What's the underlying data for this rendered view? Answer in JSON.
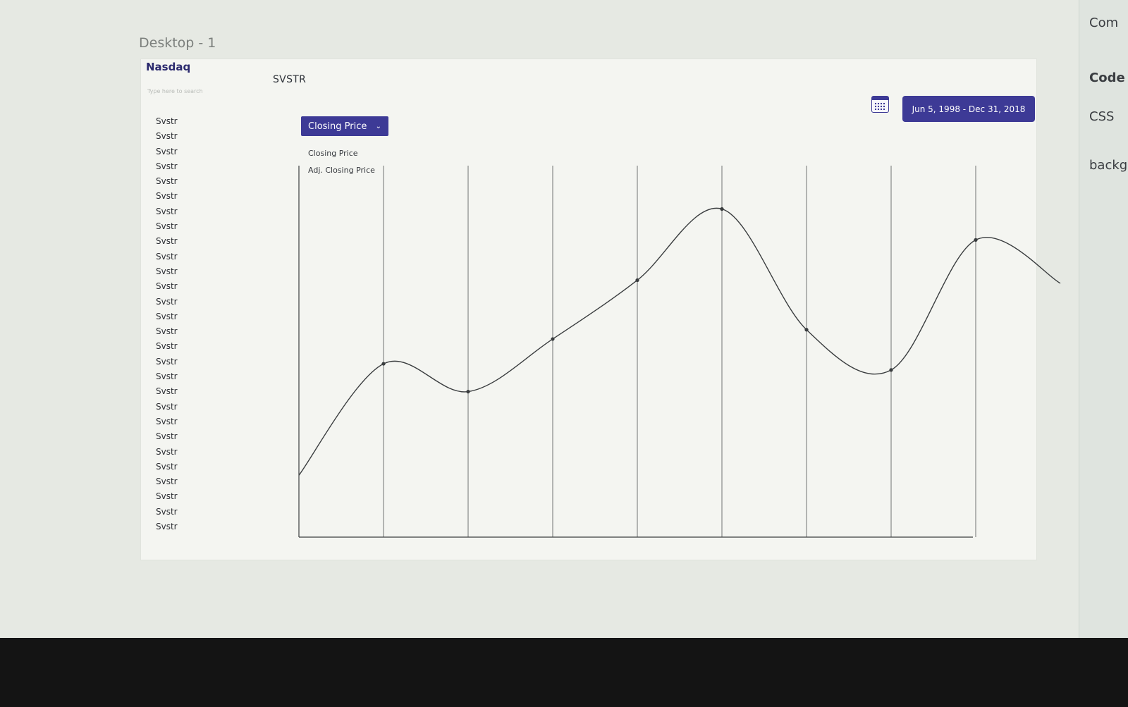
{
  "canvas": {
    "frame_label": "Desktop - 1"
  },
  "header": {
    "brand": "Nasdaq",
    "search_placeholder": "Type here to search",
    "symbol": "SVSTR"
  },
  "sidebar": {
    "tickers": [
      "Svstr",
      "Svstr",
      "Svstr",
      "Svstr",
      "Svstr",
      "Svstr",
      "Svstr",
      "Svstr",
      "Svstr",
      "Svstr",
      "Svstr",
      "Svstr",
      "Svstr",
      "Svstr",
      "Svstr",
      "Svstr",
      "Svstr",
      "Svstr",
      "Svstr",
      "Svstr",
      "Svstr",
      "Svstr",
      "Svstr",
      "Svstr",
      "Svstr",
      "Svstr",
      "Svstr",
      "Svstr"
    ]
  },
  "controls": {
    "price_select": "Closing Price",
    "price_options": [
      "Closing Price",
      "Adj. Closing Price"
    ],
    "date_range": "Jun 5, 1998 - Dec 31, 2018",
    "calendar_icon": "calendar-icon",
    "accent_color": "#3d3a96"
  },
  "chart_data": {
    "type": "line",
    "x": [
      0,
      1,
      2,
      3,
      4,
      5,
      6,
      7,
      8,
      9
    ],
    "y": [
      1.0,
      2.8,
      2.35,
      3.2,
      4.15,
      5.3,
      3.35,
      2.7,
      4.8,
      4.1
    ],
    "xlabel": "",
    "ylabel": "",
    "ylim": [
      0,
      6
    ],
    "grid": "vertical",
    "marker_indices": [
      1,
      2,
      3,
      4,
      5,
      6,
      7,
      8
    ],
    "line_color": "#3a3d3f"
  },
  "right_panel": {
    "items": [
      "Com",
      "Code",
      "CSS",
      "backg"
    ]
  }
}
